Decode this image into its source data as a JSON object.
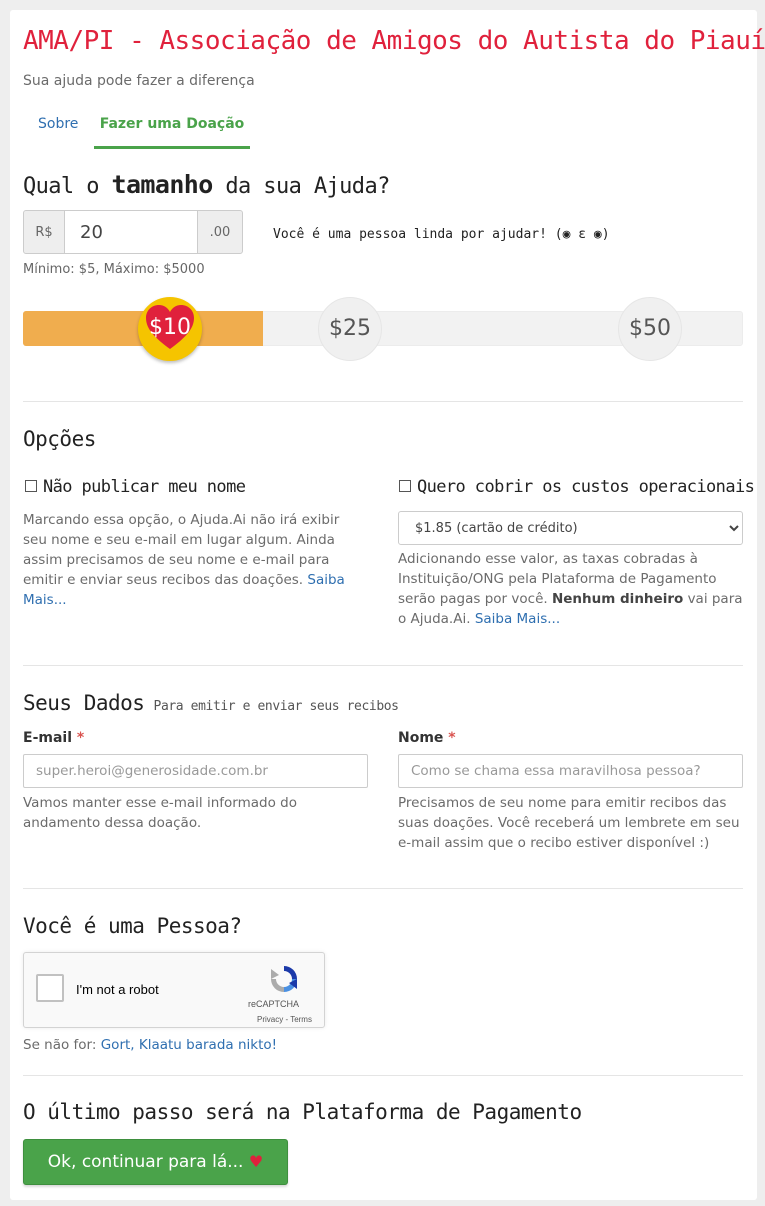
{
  "header": {
    "title": "AMA/PI - Associação de Amigos do Autista do Piauí",
    "subtitle": "Sua ajuda pode fazer a diferença"
  },
  "tabs": [
    {
      "label": "Sobre",
      "active": false
    },
    {
      "label": "Fazer uma Doação",
      "active": true
    }
  ],
  "amount": {
    "heading_pre": "Qual o",
    "heading_bold": "tamanho",
    "heading_post": "da sua Ajuda?",
    "prefix": "R$",
    "value": "20",
    "suffix": ".00",
    "thanks": "Você é uma pessoa linda por ajudar! (◉ ε ◉)",
    "limits": "Mínimo: $5, Máximo: $5000"
  },
  "slider": {
    "selected_label": "$10",
    "ticks": [
      "$25",
      "$50"
    ],
    "fill_fraction": 0.333,
    "accent": "#f0ad4e",
    "handle_color": "#f5c400",
    "handle_icon": "heart-icon"
  },
  "options": {
    "heading": "Opções",
    "hide_name": {
      "label": "Não publicar meu nome",
      "checked": false,
      "desc": "Marcando essa opção, o Ajuda.Ai não irá exibir seu nome e seu e-mail em lugar algum. Ainda assim precisamos de seu nome e e-mail para emitir e enviar seus recibos das doações.",
      "link": "Saiba Mais..."
    },
    "cover_costs": {
      "label": "Quero cobrir os custos operacionais",
      "checked": false,
      "select_value": "$1.85 (cartão de crédito)",
      "desc_pre": "Adicionando esse valor, as taxas cobradas à Instituição/ONG pela Plataforma de Pagamento serão pagas por você.",
      "desc_bold": "Nenhum dinheiro",
      "desc_post": "vai para o Ajuda.Ai.",
      "link": "Saiba Mais..."
    }
  },
  "personal": {
    "heading": "Seus Dados",
    "heading_note": "Para emitir e enviar seus recibos",
    "email": {
      "label": "E-mail",
      "required": "*",
      "placeholder": "super.heroi@generosidade.com.br",
      "help": "Vamos manter esse e-mail informado do andamento dessa doação."
    },
    "name": {
      "label": "Nome",
      "required": "*",
      "placeholder": "Como se chama essa maravilhosa pessoa?",
      "help": "Precisamos de seu nome para emitir recibos das suas doações. Você receberá um lembrete em seu e-mail assim que o recibo estiver disponível :)"
    }
  },
  "captcha": {
    "heading": "Você é uma Pessoa?",
    "checkbox_label": "I'm not a robot",
    "brand": "reCAPTCHA",
    "links": "Privacy - Terms",
    "footer_pre": "Se não for:",
    "footer_link": "Gort, Klaatu barada nikto!"
  },
  "final": {
    "heading": "O último passo será na Plataforma de Pagamento",
    "button_label": "Ok, continuar para lá...",
    "button_icon": "♥",
    "button_color": "#4aa34a"
  }
}
